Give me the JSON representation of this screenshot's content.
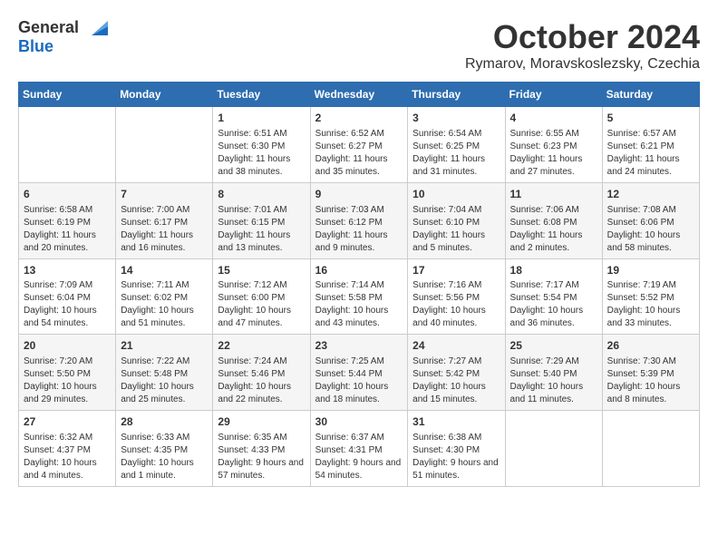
{
  "logo": {
    "general": "General",
    "blue": "Blue"
  },
  "title": "October 2024",
  "subtitle": "Rymarov, Moravskoslezsky, Czechia",
  "headers": [
    "Sunday",
    "Monday",
    "Tuesday",
    "Wednesday",
    "Thursday",
    "Friday",
    "Saturday"
  ],
  "rows": [
    [
      {
        "day": "",
        "content": ""
      },
      {
        "day": "",
        "content": ""
      },
      {
        "day": "1",
        "content": "Sunrise: 6:51 AM\nSunset: 6:30 PM\nDaylight: 11 hours and 38 minutes."
      },
      {
        "day": "2",
        "content": "Sunrise: 6:52 AM\nSunset: 6:27 PM\nDaylight: 11 hours and 35 minutes."
      },
      {
        "day": "3",
        "content": "Sunrise: 6:54 AM\nSunset: 6:25 PM\nDaylight: 11 hours and 31 minutes."
      },
      {
        "day": "4",
        "content": "Sunrise: 6:55 AM\nSunset: 6:23 PM\nDaylight: 11 hours and 27 minutes."
      },
      {
        "day": "5",
        "content": "Sunrise: 6:57 AM\nSunset: 6:21 PM\nDaylight: 11 hours and 24 minutes."
      }
    ],
    [
      {
        "day": "6",
        "content": "Sunrise: 6:58 AM\nSunset: 6:19 PM\nDaylight: 11 hours and 20 minutes."
      },
      {
        "day": "7",
        "content": "Sunrise: 7:00 AM\nSunset: 6:17 PM\nDaylight: 11 hours and 16 minutes."
      },
      {
        "day": "8",
        "content": "Sunrise: 7:01 AM\nSunset: 6:15 PM\nDaylight: 11 hours and 13 minutes."
      },
      {
        "day": "9",
        "content": "Sunrise: 7:03 AM\nSunset: 6:12 PM\nDaylight: 11 hours and 9 minutes."
      },
      {
        "day": "10",
        "content": "Sunrise: 7:04 AM\nSunset: 6:10 PM\nDaylight: 11 hours and 5 minutes."
      },
      {
        "day": "11",
        "content": "Sunrise: 7:06 AM\nSunset: 6:08 PM\nDaylight: 11 hours and 2 minutes."
      },
      {
        "day": "12",
        "content": "Sunrise: 7:08 AM\nSunset: 6:06 PM\nDaylight: 10 hours and 58 minutes."
      }
    ],
    [
      {
        "day": "13",
        "content": "Sunrise: 7:09 AM\nSunset: 6:04 PM\nDaylight: 10 hours and 54 minutes."
      },
      {
        "day": "14",
        "content": "Sunrise: 7:11 AM\nSunset: 6:02 PM\nDaylight: 10 hours and 51 minutes."
      },
      {
        "day": "15",
        "content": "Sunrise: 7:12 AM\nSunset: 6:00 PM\nDaylight: 10 hours and 47 minutes."
      },
      {
        "day": "16",
        "content": "Sunrise: 7:14 AM\nSunset: 5:58 PM\nDaylight: 10 hours and 43 minutes."
      },
      {
        "day": "17",
        "content": "Sunrise: 7:16 AM\nSunset: 5:56 PM\nDaylight: 10 hours and 40 minutes."
      },
      {
        "day": "18",
        "content": "Sunrise: 7:17 AM\nSunset: 5:54 PM\nDaylight: 10 hours and 36 minutes."
      },
      {
        "day": "19",
        "content": "Sunrise: 7:19 AM\nSunset: 5:52 PM\nDaylight: 10 hours and 33 minutes."
      }
    ],
    [
      {
        "day": "20",
        "content": "Sunrise: 7:20 AM\nSunset: 5:50 PM\nDaylight: 10 hours and 29 minutes."
      },
      {
        "day": "21",
        "content": "Sunrise: 7:22 AM\nSunset: 5:48 PM\nDaylight: 10 hours and 25 minutes."
      },
      {
        "day": "22",
        "content": "Sunrise: 7:24 AM\nSunset: 5:46 PM\nDaylight: 10 hours and 22 minutes."
      },
      {
        "day": "23",
        "content": "Sunrise: 7:25 AM\nSunset: 5:44 PM\nDaylight: 10 hours and 18 minutes."
      },
      {
        "day": "24",
        "content": "Sunrise: 7:27 AM\nSunset: 5:42 PM\nDaylight: 10 hours and 15 minutes."
      },
      {
        "day": "25",
        "content": "Sunrise: 7:29 AM\nSunset: 5:40 PM\nDaylight: 10 hours and 11 minutes."
      },
      {
        "day": "26",
        "content": "Sunrise: 7:30 AM\nSunset: 5:39 PM\nDaylight: 10 hours and 8 minutes."
      }
    ],
    [
      {
        "day": "27",
        "content": "Sunrise: 6:32 AM\nSunset: 4:37 PM\nDaylight: 10 hours and 4 minutes."
      },
      {
        "day": "28",
        "content": "Sunrise: 6:33 AM\nSunset: 4:35 PM\nDaylight: 10 hours and 1 minute."
      },
      {
        "day": "29",
        "content": "Sunrise: 6:35 AM\nSunset: 4:33 PM\nDaylight: 9 hours and 57 minutes."
      },
      {
        "day": "30",
        "content": "Sunrise: 6:37 AM\nSunset: 4:31 PM\nDaylight: 9 hours and 54 minutes."
      },
      {
        "day": "31",
        "content": "Sunrise: 6:38 AM\nSunset: 4:30 PM\nDaylight: 9 hours and 51 minutes."
      },
      {
        "day": "",
        "content": ""
      },
      {
        "day": "",
        "content": ""
      }
    ]
  ]
}
